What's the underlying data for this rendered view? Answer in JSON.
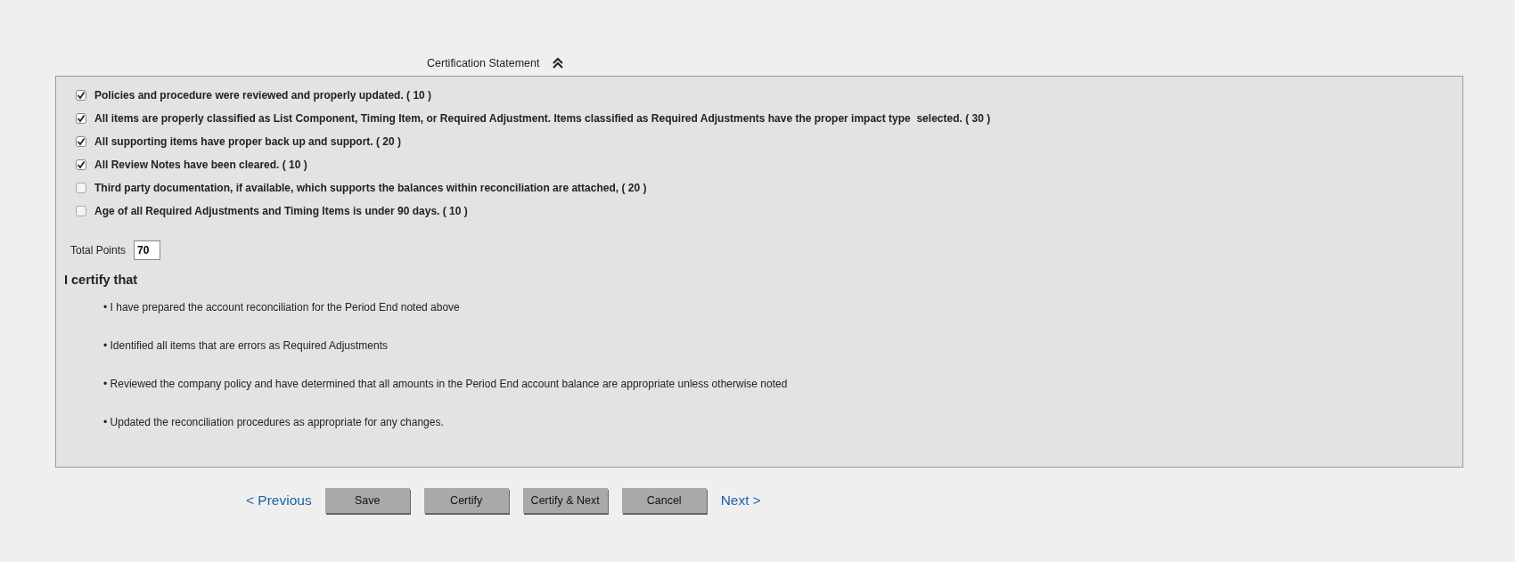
{
  "section": {
    "title": "Certification Statement",
    "expanded": true
  },
  "checklist": [
    {
      "label": "Policies and procedure were reviewed and properly updated. ( 10 )",
      "checked": true
    },
    {
      "label": "All items are properly classified as List Component, Timing Item, or Required Adjustment. Items classified as Required Adjustments have the proper impact type  selected. ( 30 )",
      "checked": true
    },
    {
      "label": "All supporting items have proper back up and support. ( 20 )",
      "checked": true
    },
    {
      "label": "All Review Notes have been cleared. ( 10 )",
      "checked": true
    },
    {
      "label": "Third party documentation, if available, which supports the balances within reconciliation are attached, ( 20 )",
      "checked": false
    },
    {
      "label": "Age of all Required Adjustments and Timing Items is under 90 days. ( 10 )",
      "checked": false
    }
  ],
  "total_points": {
    "label": "Total Points",
    "value": "70"
  },
  "certify": {
    "heading": "I certify that",
    "statements": [
      "• I have prepared the account reconciliation for the Period End noted above",
      "• Identified all items that are errors as Required Adjustments",
      "• Reviewed the company policy and have determined that all amounts in the Period End account balance are appropriate unless otherwise noted",
      "• Updated the reconciliation procedures as appropriate for any changes."
    ]
  },
  "actions": [
    {
      "kind": "link",
      "label": "< Previous"
    },
    {
      "kind": "button",
      "label": "Save"
    },
    {
      "kind": "button",
      "label": "Certify"
    },
    {
      "kind": "button",
      "label": "Certify & Next"
    },
    {
      "kind": "button",
      "label": "Cancel"
    },
    {
      "kind": "link",
      "label": "Next >"
    }
  ]
}
